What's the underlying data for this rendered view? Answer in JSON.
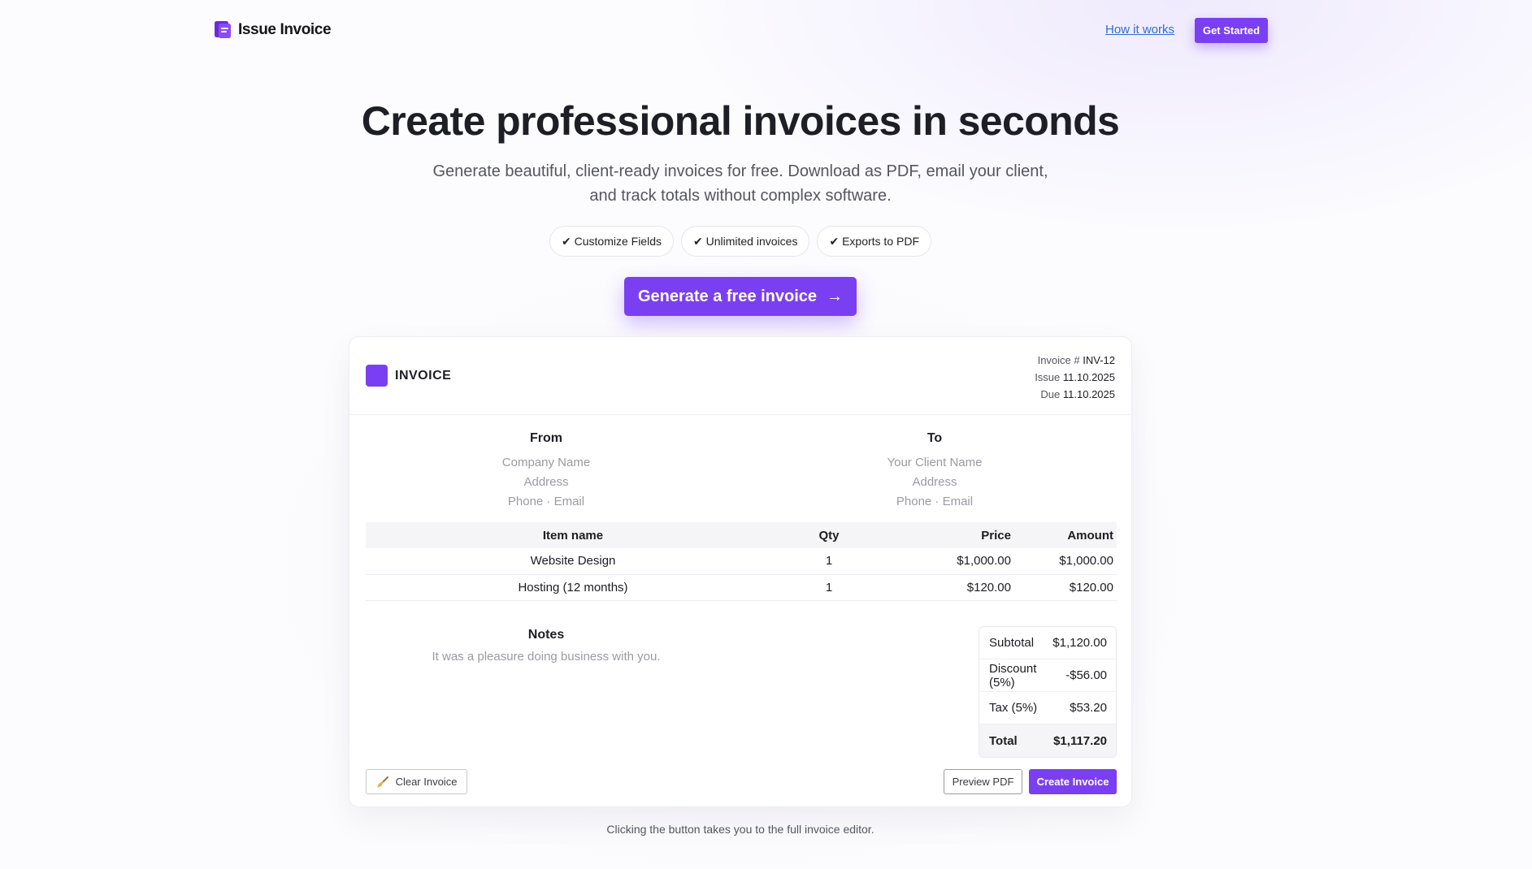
{
  "nav": {
    "brand": "Issue Invoice",
    "how_it_works": "How it works",
    "get_started": "Get Started"
  },
  "hero": {
    "title": "Create professional invoices in seconds",
    "subtitle_line1": "Generate beautiful, client-ready invoices for free. Download as PDF, email your client,",
    "subtitle_line2": "and track totals without complex software.",
    "pills": [
      "✔ Customize Fields",
      "✔ Unlimited invoices",
      "✔ Exports to PDF"
    ],
    "cta": "Generate a free invoice",
    "cta_arrow": "→"
  },
  "invoice": {
    "title": "INVOICE",
    "number_label": "Invoice #",
    "number": "INV-12",
    "issue_label": "Issue",
    "issue_date": "11.10.2025",
    "due_label": "Due",
    "due_date": "11.10.2025",
    "from": {
      "heading": "From",
      "company": "Company Name",
      "address": "Address",
      "contact": "Phone · Email"
    },
    "to": {
      "heading": "To",
      "client": "Your Client Name",
      "address": "Address",
      "contact": "Phone · Email"
    },
    "table": {
      "headers": {
        "name": "Item name",
        "qty": "Qty",
        "price": "Price",
        "amount": "Amount"
      },
      "rows": [
        {
          "name": "Website Design",
          "qty": "1",
          "price": "$1,000.00",
          "amount": "$1,000.00"
        },
        {
          "name": "Hosting (12 months)",
          "qty": "1",
          "price": "$120.00",
          "amount": "$120.00"
        }
      ]
    },
    "notes": {
      "heading": "Notes",
      "text": "It was a pleasure doing business with you."
    },
    "totals": [
      {
        "label": "Subtotal",
        "value": "$1,120.00"
      },
      {
        "label": "Discount (5%)",
        "value": "-$56.00"
      },
      {
        "label": "Tax (5%)",
        "value": "$53.20"
      },
      {
        "label": "Total",
        "value": "$1,117.20"
      }
    ],
    "buttons": {
      "clear": "Clear Invoice",
      "preview": "Preview PDF",
      "create": "Create Invoice"
    }
  },
  "footnote": "Clicking the button takes you to the full invoice editor.",
  "colors": {
    "accent": "#7b3ff2",
    "link": "#2a6fd8"
  },
  "icons": {
    "brand": "invoice-doc-icon",
    "clear": "broom-icon",
    "cta_arrow": "arrow-right-icon"
  }
}
